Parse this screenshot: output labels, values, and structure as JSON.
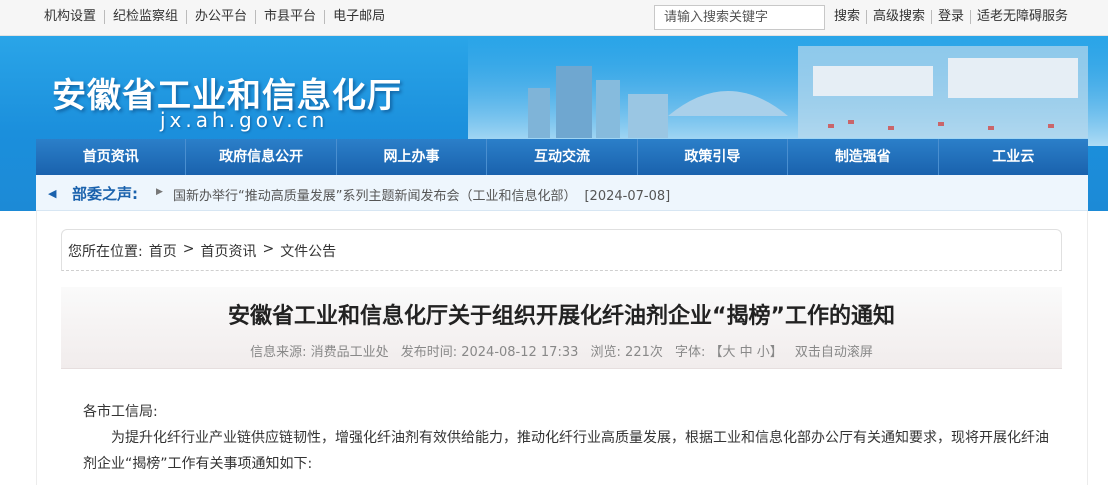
{
  "topbar": {
    "links": [
      "机构设置",
      "纪检监察组",
      "办公平台",
      "市县平台",
      "电子邮局"
    ],
    "search_placeholder": "请输入搜索关键字",
    "right_links": [
      "搜索",
      "高级搜索",
      "登录",
      "适老无障碍服务"
    ]
  },
  "banner": {
    "title": "安徽省工业和信息化厅",
    "domain": "jx.ah.gov.cn"
  },
  "nav": [
    "首页资讯",
    "政府信息公开",
    "网上办事",
    "互动交流",
    "政策引导",
    "制造强省",
    "工业云"
  ],
  "ticker": {
    "label": "部委之声:",
    "headline": "国新办举行“推动高质量发展”系列主题新闻发布会（工业和信息化部）",
    "date": "[2024-07-08]"
  },
  "breadcrumb": {
    "prefix": "您所在位置:",
    "items": [
      "首页",
      ">",
      "首页资讯",
      ">",
      "文件公告"
    ]
  },
  "article": {
    "title": "安徽省工业和信息化厅关于组织开展化纤油剂企业“揭榜”工作的通知",
    "meta": {
      "source": "信息来源: 消费品工业处",
      "time": "发布时间: 2024-08-12 17:33",
      "views": "浏览: 221次",
      "font": "字体: 【大 中 小】",
      "scroll": "双击自动滚屏"
    },
    "greeting": "各市工信局:",
    "paragraph": "为提升化纤行业产业链供应链韧性，增强化纤油剂有效供给能力，推动化纤行业高质量发展，根据工业和信息化部办公厅有关通知要求，现将开展化纤油剂企业“揭榜”工作有关事项通知如下:"
  }
}
